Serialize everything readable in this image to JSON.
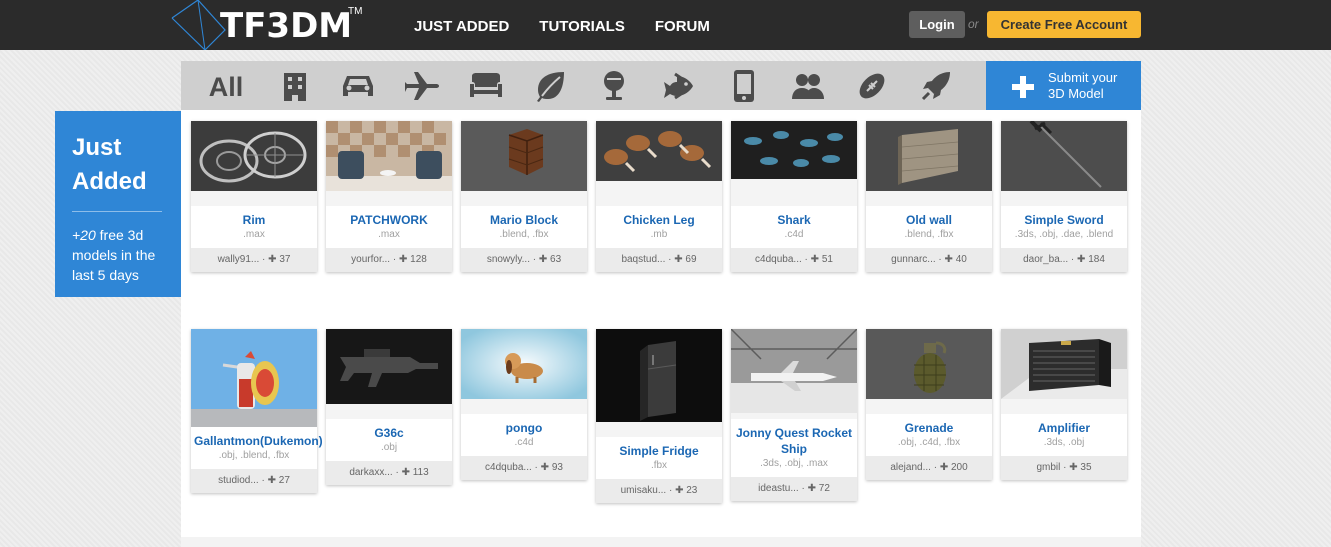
{
  "header": {
    "logo": "TF3DM",
    "tm": "TM",
    "nav": [
      "JUST ADDED",
      "TUTORIALS",
      "FORUM"
    ],
    "login": "Login",
    "or": "or",
    "create_account": "Create Free Account"
  },
  "categories": {
    "all": "All",
    "icons": [
      "building-icon",
      "car-icon",
      "airplane-icon",
      "furniture-icon",
      "leaf-icon",
      "food-icon",
      "fish-icon",
      "phone-icon",
      "people-icon",
      "sports-icon",
      "rocket-icon"
    ]
  },
  "submit": {
    "line1": "Submit your",
    "line2": "3D Model"
  },
  "sidebar": {
    "title_line1": "Just",
    "title_line2": "Added",
    "count": "+20",
    "desc_rest": " free 3d models in the last 5 days"
  },
  "models": [
    {
      "title": "Rim",
      "formats": ".max",
      "author": "wally91...",
      "downloads": "37"
    },
    {
      "title": "PATCHWORK",
      "formats": ".max",
      "author": "yourfor...",
      "downloads": "128"
    },
    {
      "title": "Mario Block",
      "formats": ".blend, .fbx",
      "author": "snowyly...",
      "downloads": "63"
    },
    {
      "title": "Chicken Leg",
      "formats": ".mb",
      "author": "baqstud...",
      "downloads": "69"
    },
    {
      "title": "Shark",
      "formats": ".c4d",
      "author": "c4dquba...",
      "downloads": "51"
    },
    {
      "title": "Old wall",
      "formats": ".blend, .fbx",
      "author": "gunnarc...",
      "downloads": "40"
    },
    {
      "title": "Simple Sword",
      "formats": ".3ds, .obj, .dae, .blend",
      "author": "daor_ba...",
      "downloads": "184"
    },
    {
      "title": "Gallantmon(Dukemon)",
      "formats": ".obj, .blend, .fbx",
      "author": "studiod...",
      "downloads": "27"
    },
    {
      "title": "G36c",
      "formats": ".obj",
      "author": "darkaxx...",
      "downloads": "113"
    },
    {
      "title": "pongo",
      "formats": ".c4d",
      "author": "c4dquba...",
      "downloads": "93"
    },
    {
      "title": "Simple Fridge",
      "formats": ".fbx",
      "author": "umisaku...",
      "downloads": "23"
    },
    {
      "title": "Jonny Quest Rocket Ship",
      "formats": ".3ds, .obj, .max",
      "author": "ideastu...",
      "downloads": "72"
    },
    {
      "title": "Grenade",
      "formats": ".obj, .c4d, .fbx",
      "author": "alejand...",
      "downloads": "200"
    },
    {
      "title": "Amplifier",
      "formats": ".3ds, .obj",
      "author": "gmbil",
      "downloads": "35"
    }
  ],
  "colors": {
    "topbar": "#2b2b2b",
    "accent_blue": "#2f86d6",
    "title_blue": "#1b67b3",
    "create_yellow": "#f7b731",
    "login_gray": "#5e5e5e"
  }
}
